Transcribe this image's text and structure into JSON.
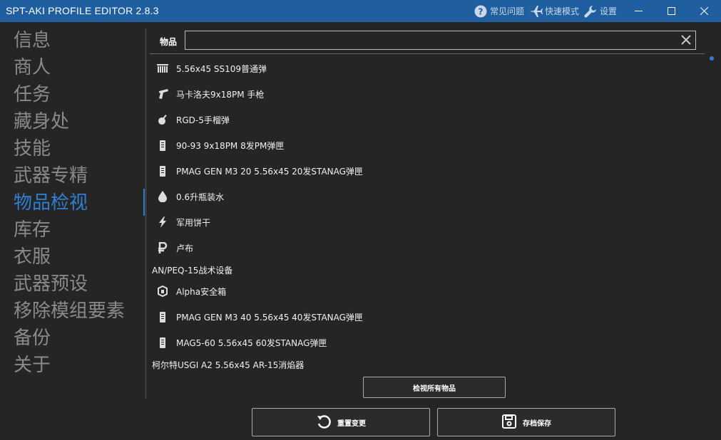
{
  "app": {
    "title": "SPT-AKI PROFILE EDITOR  2.8.3",
    "actions": [
      {
        "icon": "help-circle-icon",
        "label": "常见问题"
      },
      {
        "icon": "airplane-icon",
        "label": "快速模式"
      },
      {
        "icon": "wrench-icon",
        "label": "设置"
      }
    ],
    "window_controls": [
      "minimize-icon",
      "maximize-icon",
      "close-icon"
    ]
  },
  "sidebar": {
    "items": [
      {
        "label": "信息"
      },
      {
        "label": "商人"
      },
      {
        "label": "任务"
      },
      {
        "label": "藏身处"
      },
      {
        "label": "技能"
      },
      {
        "label": "武器专精"
      },
      {
        "label": "物品检视",
        "active": true
      },
      {
        "label": "库存"
      },
      {
        "label": "衣服"
      },
      {
        "label": "武器预设"
      },
      {
        "label": "移除模组要素"
      },
      {
        "label": "备份"
      },
      {
        "label": "关于"
      }
    ]
  },
  "search": {
    "label": "物品",
    "value": "",
    "placeholder": ""
  },
  "items": [
    {
      "icon": "ammo-box-icon",
      "label": "5.56x45 SS109普通弹"
    },
    {
      "icon": "pistol-icon",
      "label": "马卡洛夫9x18PM 手枪"
    },
    {
      "icon": "grenade-icon",
      "label": "RGD-5手榴弹"
    },
    {
      "icon": "magazine-icon",
      "label": "90-93 9x18PM 8发PM弹匣"
    },
    {
      "icon": "magazine-icon",
      "label": "PMAG GEN M3 20 5.56x45 20发STANAG弹匣"
    },
    {
      "icon": "water-drop-icon",
      "label": "0.6升瓶装水"
    },
    {
      "icon": "lightning-icon",
      "label": "军用饼干"
    },
    {
      "icon": "ruble-icon",
      "label": "卢布"
    },
    {
      "category": true,
      "label": "AN/PEQ-15战术设备"
    },
    {
      "icon": "secure-container-icon",
      "label": "Alpha安全箱"
    },
    {
      "icon": "magazine-icon",
      "label": "PMAG GEN M3 40 5.56x45 40发STANAG弹匣"
    },
    {
      "icon": "magazine-icon",
      "label": "MAG5-60 5.56x45 60发STANAG弹匣"
    },
    {
      "category": true,
      "label": "柯尔特USGI A2 5.56x45 AR-15消焰器"
    }
  ],
  "buttons": {
    "view_all": "检视所有物品",
    "reset": "重置变更",
    "save": "存档保存"
  },
  "colors": {
    "titlebar": "#1f5fa0",
    "accent": "#2f7fd1",
    "background": "#252526"
  }
}
